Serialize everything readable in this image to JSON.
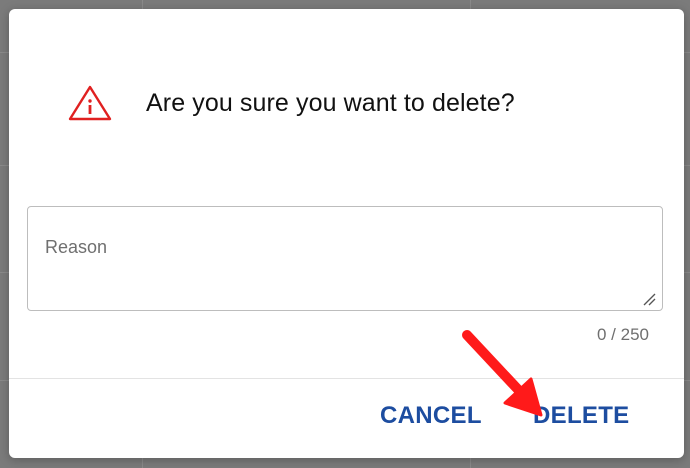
{
  "dialog": {
    "title": "Are you sure you want to delete?",
    "icon": "warning-triangle-icon",
    "icon_color": "#e02020",
    "reason": {
      "placeholder": "Reason",
      "value": "",
      "counter": "0 / 250"
    },
    "buttons": {
      "cancel_label": "CANCEL",
      "delete_label": "DELETE"
    },
    "accent_color": "#1d4da0",
    "annotation_arrow_color": "#ff1a1a"
  }
}
